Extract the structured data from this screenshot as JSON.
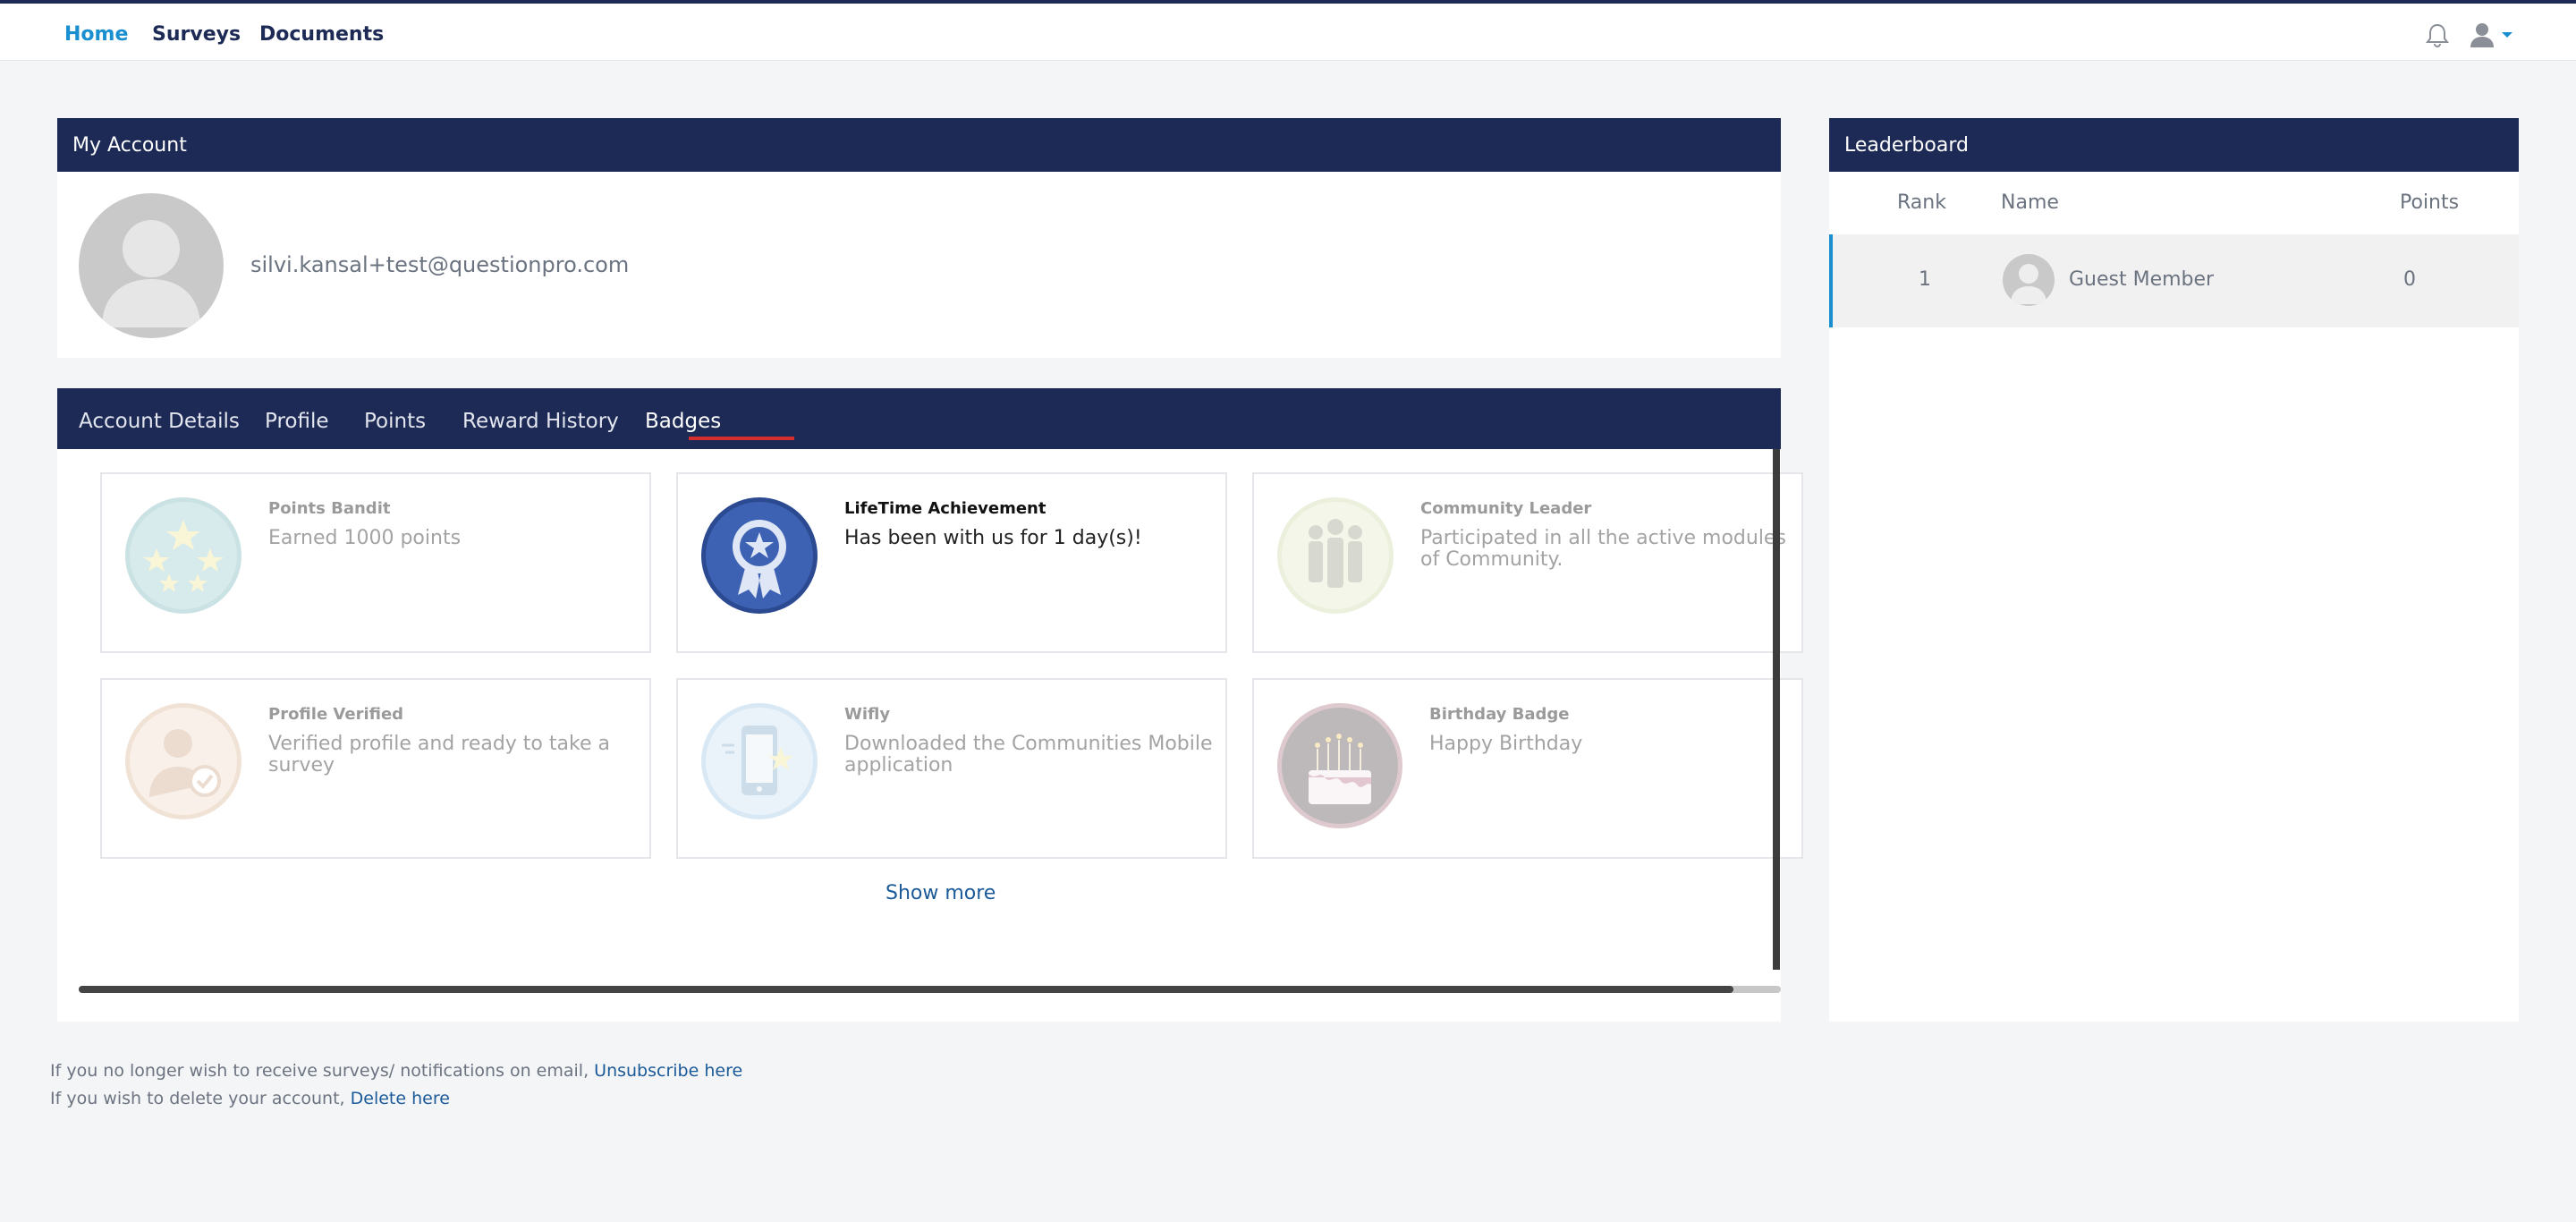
{
  "nav": {
    "home": "Home",
    "surveys": "Surveys",
    "documents": "Documents"
  },
  "account": {
    "header": "My Account",
    "email": "silvi.kansal+test@questionpro.com"
  },
  "tabs": [
    "Account Details",
    "Profile",
    "Points",
    "Reward History",
    "Badges"
  ],
  "active_tab": "Badges",
  "badges": [
    {
      "title": "Points Bandit",
      "desc": "Earned 1000 points",
      "icon": "stars-badge-icon",
      "color": "#a8d3d6",
      "earned": false
    },
    {
      "title": "LifeTime Achievement",
      "desc": "Has been with us for 1 day(s)!",
      "icon": "ribbon-medal-icon",
      "color": "#3e62b3",
      "earned": true
    },
    {
      "title": "Community Leader",
      "desc": "Participated in all the active modules of Community.",
      "icon": "people-group-icon",
      "color": "#d8e2b8",
      "earned": false
    },
    {
      "title": "Profile Verified",
      "desc": "Verified profile and ready to take a survey",
      "icon": "verified-user-icon",
      "color": "#e8c4a8",
      "earned": false
    },
    {
      "title": "Wifly",
      "desc": "Downloaded the Communities Mobile application",
      "icon": "mobile-phone-icon",
      "color": "#a9cde8",
      "earned": false
    },
    {
      "title": "Birthday Badge",
      "desc": "Happy Birthday",
      "icon": "birthday-cake-icon",
      "color": "#8a6a72",
      "earned": false
    }
  ],
  "show_more": "Show more",
  "leaderboard": {
    "header": "Leaderboard",
    "columns": {
      "rank": "Rank",
      "name": "Name",
      "points": "Points"
    },
    "rows": [
      {
        "rank": "1",
        "name": "Guest Member",
        "points": "0"
      }
    ]
  },
  "footer": {
    "line1_text": "If you no longer wish to receive surveys/ notifications on email,",
    "line1_link": "Unsubscribe here",
    "line2_text": "If you wish to delete your account,",
    "line2_link": "Delete here"
  }
}
